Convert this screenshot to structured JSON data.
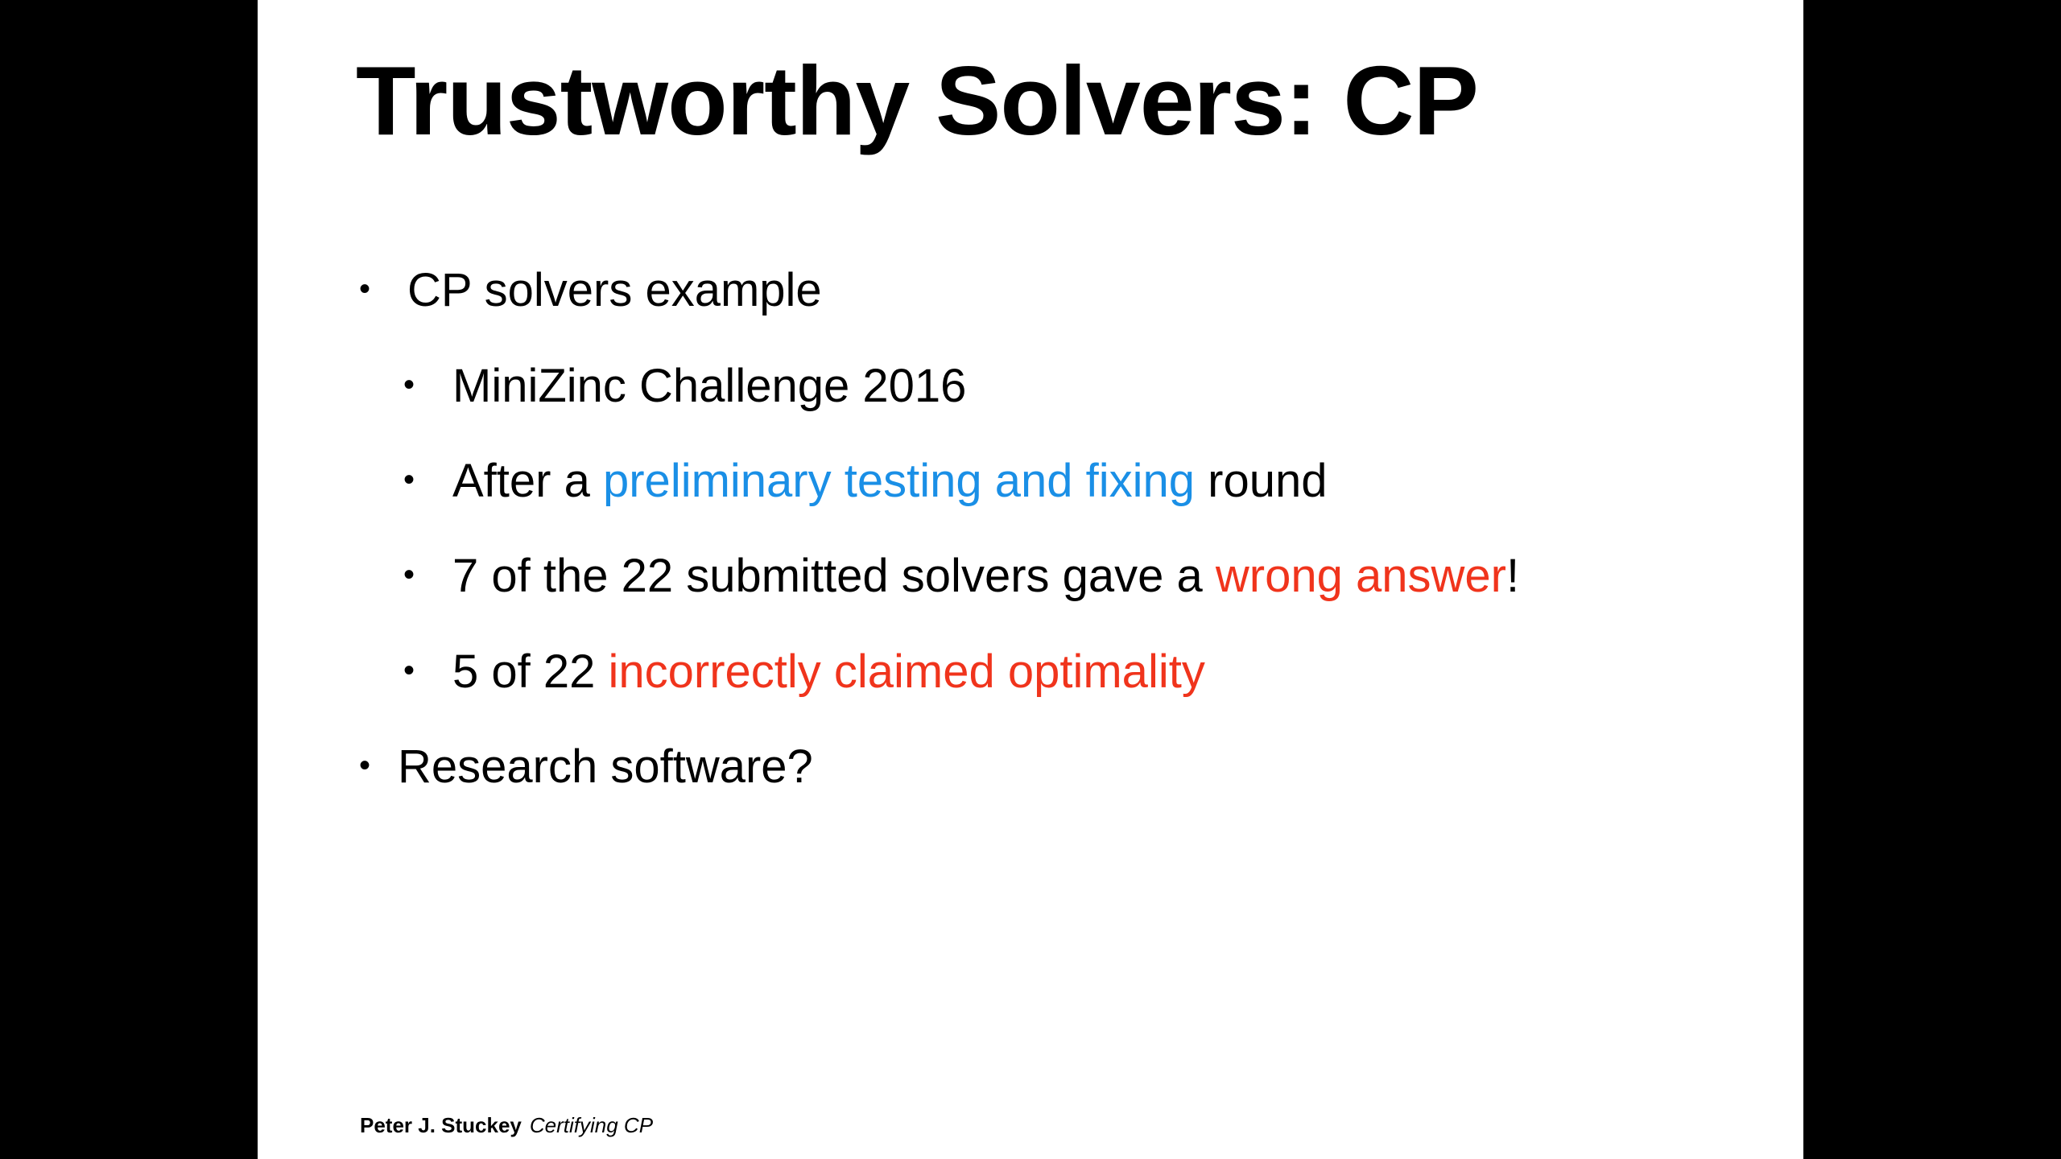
{
  "slide": {
    "title": "Trustworthy Solvers: CP",
    "bullets": {
      "b1": {
        "text": "CP solvers example"
      },
      "b1_1": {
        "text": "MiniZinc Challenge 2016"
      },
      "b1_2": {
        "before": "After a ",
        "highlight": "preliminary testing and fixing",
        "after": " round"
      },
      "b1_3": {
        "before": "7 of the 22 submitted solvers gave a ",
        "highlight": "wrong answer",
        "after": "!"
      },
      "b1_4": {
        "before": "5 of 22 ",
        "highlight": "incorrectly claimed optimality"
      },
      "b2": {
        "text": "Research software?"
      }
    },
    "bullet_glyph": "•",
    "footer": {
      "author": "Peter J. Stuckey",
      "topic": "Certifying CP"
    }
  },
  "colors": {
    "background": "#000000",
    "slide": "#ffffff",
    "text": "#000000",
    "blue_highlight": "#1a8fe6",
    "red_highlight": "#f0341c"
  }
}
